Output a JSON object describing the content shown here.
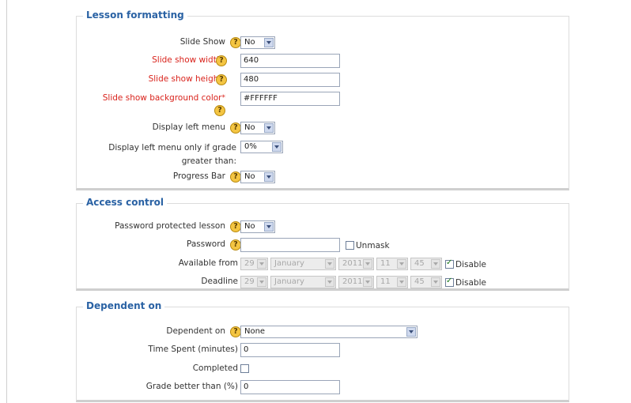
{
  "lesson_formatting": {
    "legend": "Lesson formatting",
    "slide_show": {
      "label": "Slide Show",
      "value": "No"
    },
    "slide_show_width": {
      "label": "Slide show width",
      "required_mark": "*",
      "value": "640"
    },
    "slide_show_height": {
      "label": "Slide show height",
      "required_mark": "*",
      "value": "480"
    },
    "slide_show_bg": {
      "label": "Slide show background color",
      "required_mark": "*",
      "value": "#FFFFFF"
    },
    "display_left_menu": {
      "label": "Display left menu",
      "value": "No"
    },
    "display_left_menu_grade": {
      "label_line1": "Display left menu only if grade",
      "label_line2": "greater than:",
      "value": "0%"
    },
    "progress_bar": {
      "label": "Progress Bar",
      "value": "No"
    }
  },
  "access_control": {
    "legend": "Access control",
    "password_protected": {
      "label": "Password protected lesson",
      "value": "No"
    },
    "password": {
      "label": "Password",
      "value": "",
      "unmask_label": "Unmask"
    },
    "available_from": {
      "label": "Available from",
      "day": "29",
      "month": "January",
      "year": "2011",
      "hour": "11",
      "minute": "45",
      "disable_label": "Disable"
    },
    "deadline": {
      "label": "Deadline",
      "day": "29",
      "month": "January",
      "year": "2011",
      "hour": "11",
      "minute": "45",
      "disable_label": "Disable"
    }
  },
  "dependent_on": {
    "legend": "Dependent on",
    "dependent_on": {
      "label": "Dependent on",
      "value": "None"
    },
    "time_spent": {
      "label": "Time Spent (minutes)",
      "value": "0"
    },
    "completed": {
      "label": "Completed"
    },
    "grade_better": {
      "label": "Grade better than (%)",
      "value": "0"
    }
  },
  "icons": {
    "help": "?"
  }
}
